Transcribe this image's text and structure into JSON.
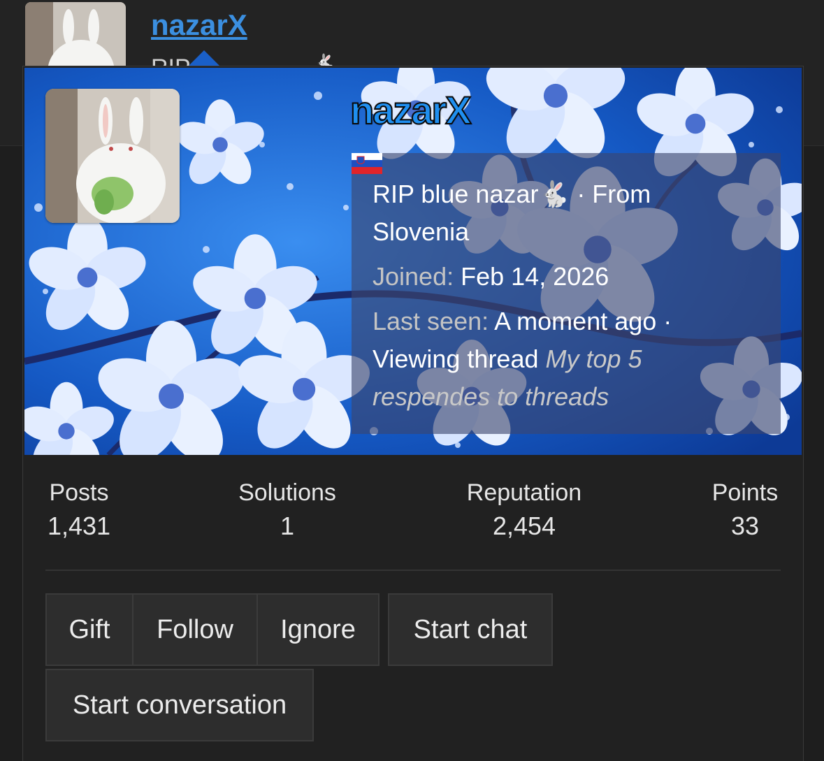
{
  "background_header": {
    "username": "nazarX",
    "subtitle_fragment": "RIP"
  },
  "card": {
    "username": "nazarX",
    "custom_title_prefix": "RIP blue nazar",
    "custom_title_emoji": "🐇",
    "location_sep": " · From",
    "location": "Slovenia",
    "joined_label": "Joined:",
    "joined_value": "Feb 14, 2026",
    "last_seen_label": "Last seen:",
    "last_seen_value": "A moment ago ·",
    "activity_prefix": "Viewing thread",
    "activity_thread": "My top 5 respendes to threads"
  },
  "stats": [
    {
      "label": "Posts",
      "value": "1,431"
    },
    {
      "label": "Solutions",
      "value": "1"
    },
    {
      "label": "Reputation",
      "value": "2,454"
    },
    {
      "label": "Points",
      "value": "33"
    }
  ],
  "buttons": {
    "gift": "Gift",
    "follow": "Follow",
    "ignore": "Ignore",
    "start_chat": "Start chat",
    "start_conversation": "Start conversation"
  },
  "colors": {
    "username_link": "#3b8fe0",
    "banner_blue": "#1a5fc7",
    "background": "#1e1e1e"
  }
}
